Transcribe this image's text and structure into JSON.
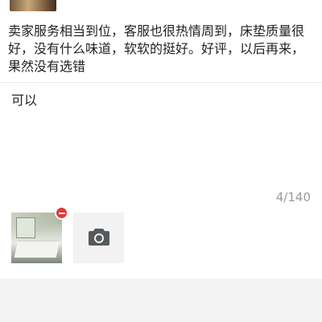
{
  "review": {
    "quoted_text": "卖家服务相当到位，客服也很热情周到，床垫质量很好，没有什么味道，软软的挺好。好评，以后再来，果然没有选错"
  },
  "reply": {
    "value": "可以",
    "counter": "4/140"
  },
  "attachments": {
    "photo_icon": "bedroom-photo",
    "remove_icon": "minus-circle-icon",
    "add_icon": "camera-icon",
    "remove_color": "#e53935"
  }
}
